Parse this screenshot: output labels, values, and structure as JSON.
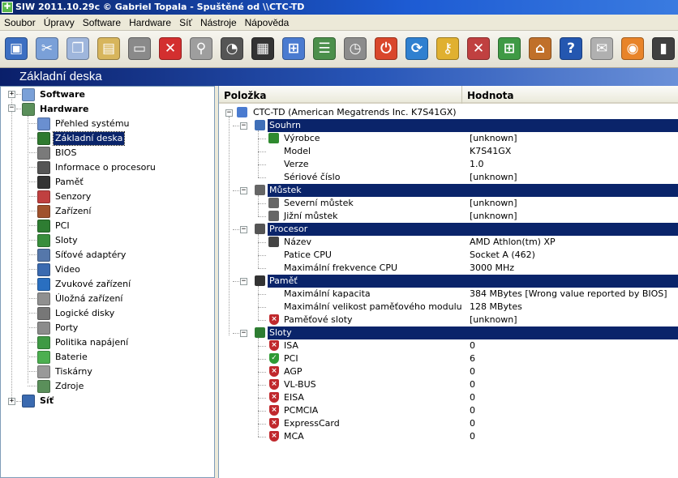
{
  "window": {
    "title": "SIW 2011.10.29c  © Gabriel Topala - Spuštěné od \\\\CTC-TD"
  },
  "menu": [
    "Soubor",
    "Úpravy",
    "Software",
    "Hardware",
    "Síť",
    "Nástroje",
    "Nápověda"
  ],
  "toolbar": [
    {
      "name": "save-icon",
      "glyph": "▣",
      "color": "#3c6fc2"
    },
    {
      "name": "cut-icon",
      "glyph": "✂",
      "color": "#7aa0d8"
    },
    {
      "name": "copy-icon",
      "glyph": "❐",
      "color": "#9fb6dc"
    },
    {
      "name": "paste-icon",
      "glyph": "▤",
      "color": "#d7b55c"
    },
    {
      "name": "print-icon",
      "glyph": "▭",
      "color": "#8a8a8a"
    },
    {
      "name": "stop-icon",
      "glyph": "✕",
      "color": "#d32f2f"
    },
    {
      "name": "search-icon",
      "glyph": "⚲",
      "color": "#9e9e9e"
    },
    {
      "name": "gauge-icon",
      "glyph": "◔",
      "color": "#555555"
    },
    {
      "name": "monitor-chart-icon",
      "glyph": "▦",
      "color": "#333333"
    },
    {
      "name": "network-icon",
      "glyph": "⊞",
      "color": "#4a7bd0"
    },
    {
      "name": "list-icon",
      "glyph": "☰",
      "color": "#4b8f4b"
    },
    {
      "name": "stopwatch-icon",
      "glyph": "◷",
      "color": "#8c8c8c"
    },
    {
      "name": "power-icon",
      "glyph": "⏻",
      "color": "#d9472b"
    },
    {
      "name": "refresh-icon",
      "glyph": "⟳",
      "color": "#2f80d0"
    },
    {
      "name": "key-icon",
      "glyph": "⚷",
      "color": "#e0b030"
    },
    {
      "name": "tools-icon",
      "glyph": "✕",
      "color": "#c04040"
    },
    {
      "name": "windows-icon",
      "glyph": "⊞",
      "color": "#3f9a45"
    },
    {
      "name": "home-icon",
      "glyph": "⌂",
      "color": "#c0702a"
    },
    {
      "name": "help-icon",
      "glyph": "?",
      "color": "#2457b0"
    },
    {
      "name": "mail-icon",
      "glyph": "✉",
      "color": "#b0b0b0"
    },
    {
      "name": "rss-icon",
      "glyph": "◉",
      "color": "#e8842a"
    },
    {
      "name": "exit-icon",
      "glyph": "▮",
      "color": "#404040"
    }
  ],
  "page_header": "Základní deska",
  "tree": {
    "software": "Software",
    "hardware": "Hardware",
    "hardware_items": [
      {
        "label": "Přehled systému",
        "icon": "system-overview-icon",
        "color": "#6a8fd0"
      },
      {
        "label": "Základní deska",
        "icon": "motherboard-icon",
        "color": "#2f7a2f",
        "selected": true
      },
      {
        "label": "BIOS",
        "icon": "bios-chip-icon",
        "color": "#7a7a7a"
      },
      {
        "label": "Informace o procesoru",
        "icon": "cpu-icon",
        "color": "#555555"
      },
      {
        "label": "Paměť",
        "icon": "memory-icon",
        "color": "#333333"
      },
      {
        "label": "Senzory",
        "icon": "sensors-icon",
        "color": "#c04040"
      },
      {
        "label": "Zařízení",
        "icon": "devices-icon",
        "color": "#a0522d"
      },
      {
        "label": "PCI",
        "icon": "pci-icon",
        "color": "#2e7d32"
      },
      {
        "label": "Sloty",
        "icon": "slots-icon",
        "color": "#388e3c"
      },
      {
        "label": "Síťové adaptéry",
        "icon": "network-adapter-icon",
        "color": "#5577aa"
      },
      {
        "label": "Video",
        "icon": "video-icon",
        "color": "#3a6ab0"
      },
      {
        "label": "Zvukové zařízení",
        "icon": "sound-icon",
        "color": "#2a6fc0"
      },
      {
        "label": "Úložná zařízení",
        "icon": "storage-icon",
        "color": "#909090"
      },
      {
        "label": "Logické disky",
        "icon": "logical-disk-icon",
        "color": "#777777"
      },
      {
        "label": "Porty",
        "icon": "ports-icon",
        "color": "#8c8c8c"
      },
      {
        "label": "Politika napájení",
        "icon": "power-policy-icon",
        "color": "#3f9a45"
      },
      {
        "label": "Baterie",
        "icon": "battery-icon",
        "color": "#4caf50"
      },
      {
        "label": "Tiskárny",
        "icon": "printer-icon",
        "color": "#999999"
      },
      {
        "label": "Zdroje",
        "icon": "resources-icon",
        "color": "#5a8f5a"
      }
    ],
    "network": "Síť"
  },
  "table": {
    "col_item": "Položka",
    "col_value": "Hodnota",
    "root": "CTC-TD (American Megatrends Inc. K7S41GX)",
    "sections": [
      {
        "title": "Souhrn",
        "icon": "summary-icon",
        "color": "#3f6fb8",
        "rows": [
          {
            "k": "Výrobce",
            "v": "[unknown]",
            "icon": "green-board-icon",
            "icolor": "#2f8a2f"
          },
          {
            "k": "Model",
            "v": "K7S41GX"
          },
          {
            "k": "Verze",
            "v": "1.0"
          },
          {
            "k": "Sériové číslo",
            "v": "[unknown]"
          }
        ]
      },
      {
        "title": "Můstek",
        "icon": "chipset-icon",
        "color": "#666666",
        "rows": [
          {
            "k": "Severní můstek",
            "v": "[unknown]",
            "icon": "chip-icon",
            "icolor": "#666666"
          },
          {
            "k": "Jižní můstek",
            "v": "[unknown]",
            "icon": "chip-icon",
            "icolor": "#666666"
          }
        ]
      },
      {
        "title": "Procesor",
        "icon": "processor-icon",
        "color": "#555555",
        "rows": [
          {
            "k": "Název",
            "v": "AMD Athlon(tm) XP",
            "icon": "cpu-chip-icon",
            "icolor": "#444444"
          },
          {
            "k": "Patice CPU",
            "v": "Socket A (462)"
          },
          {
            "k": "Maximální frekvence CPU",
            "v": "3000 MHz"
          }
        ]
      },
      {
        "title": "Paměť",
        "icon": "memory-module-icon",
        "color": "#333333",
        "rows": [
          {
            "k": "Maximální kapacita",
            "v": "384 MBytes [Wrong value reported by BIOS]"
          },
          {
            "k": "Maximální velikost paměťového modulu",
            "v": "128 MBytes"
          },
          {
            "k": "Paměťové sloty",
            "v": "[unknown]",
            "shield": "red"
          }
        ]
      },
      {
        "title": "Sloty",
        "icon": "slot-card-icon",
        "color": "#2e7d32",
        "rows": [
          {
            "k": "ISA",
            "v": "0",
            "shield": "red"
          },
          {
            "k": "PCI",
            "v": "6",
            "shield": "green"
          },
          {
            "k": "AGP",
            "v": "0",
            "shield": "red"
          },
          {
            "k": "VL-BUS",
            "v": "0",
            "shield": "red"
          },
          {
            "k": "EISA",
            "v": "0",
            "shield": "red"
          },
          {
            "k": "PCMCIA",
            "v": "0",
            "shield": "red"
          },
          {
            "k": "ExpressCard",
            "v": "0",
            "shield": "red"
          },
          {
            "k": "MCA",
            "v": "0",
            "shield": "red"
          }
        ]
      }
    ]
  }
}
